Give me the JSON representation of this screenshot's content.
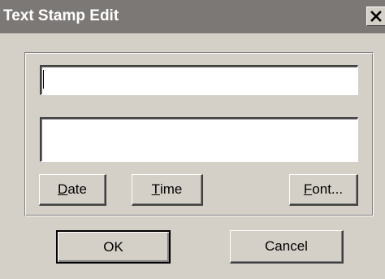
{
  "window": {
    "title": "Text Stamp Edit",
    "close_icon": "close-icon"
  },
  "fields": {
    "line1_value": "",
    "line2_value": ""
  },
  "buttons": {
    "date": {
      "mnemonic": "D",
      "rest": "ate"
    },
    "time": {
      "mnemonic": "T",
      "rest": "ime"
    },
    "font": {
      "mnemonic": "F",
      "rest": "ont..."
    },
    "ok": "OK",
    "cancel": "Cancel"
  }
}
